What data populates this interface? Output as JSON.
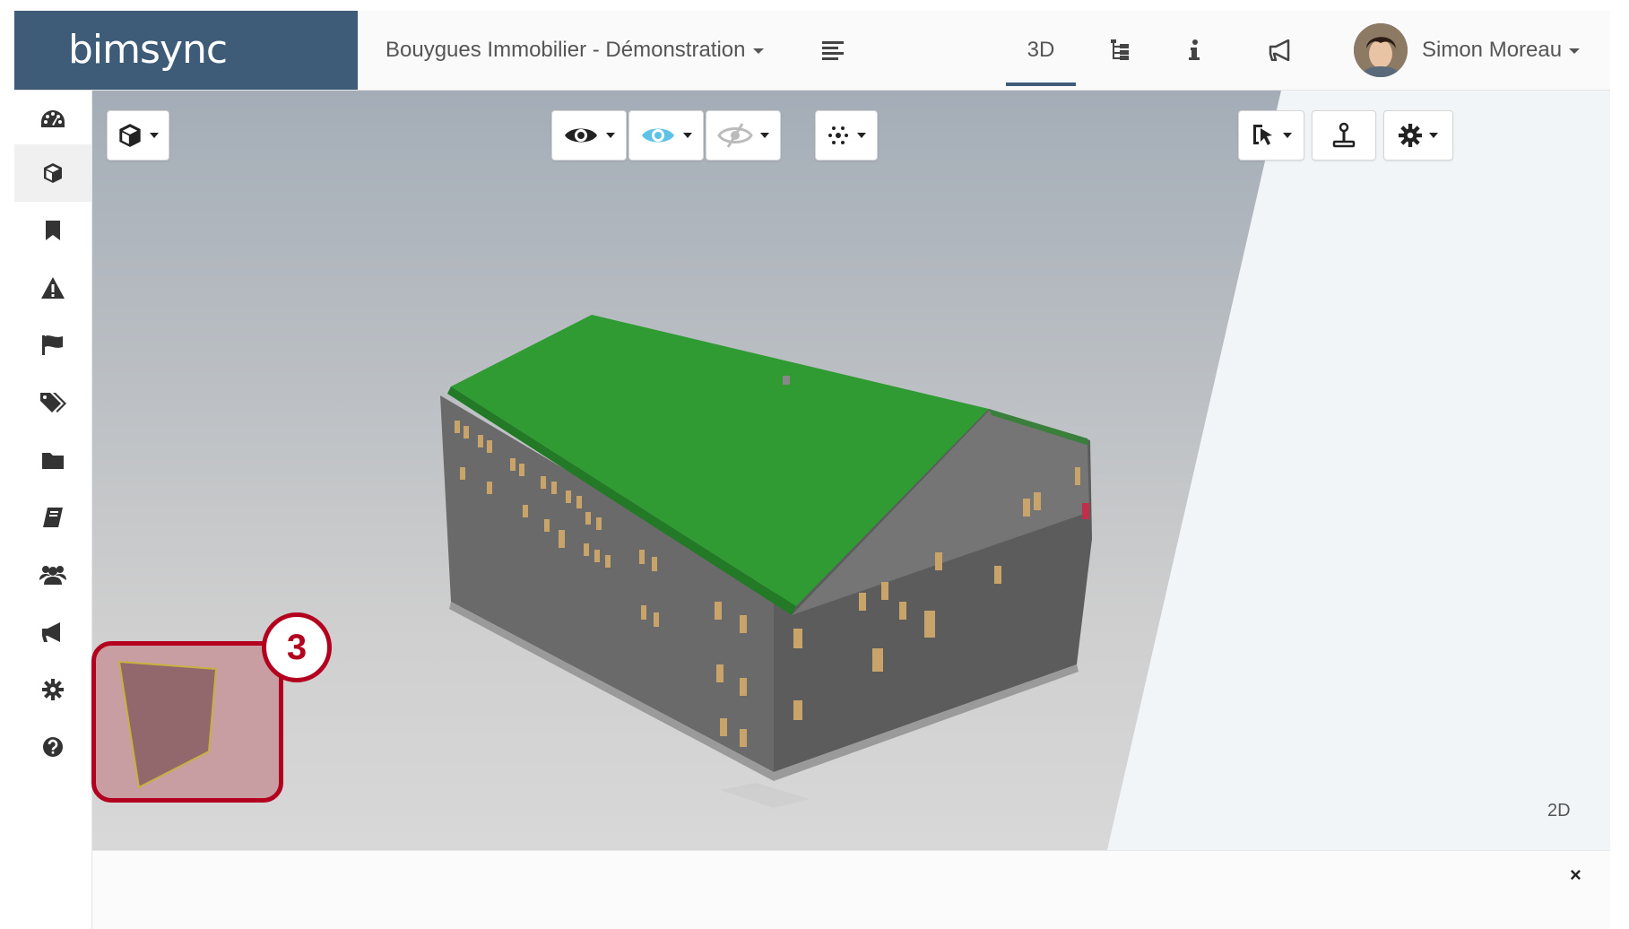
{
  "header": {
    "brand": "bimsync",
    "project": "Bouygues Immobilier - Démonstration",
    "nav": {
      "list_icon": "list-lines-icon",
      "tab_3d": "3D",
      "tree_icon": "tree-icon",
      "info_icon": "info-icon",
      "announce_icon": "megaphone-icon"
    },
    "user": "Simon Moreau"
  },
  "sidebar": {
    "items": [
      {
        "icon": "dashboard-icon"
      },
      {
        "icon": "cube-icon",
        "active": true
      },
      {
        "icon": "bookmark-icon"
      },
      {
        "icon": "warning-icon"
      },
      {
        "icon": "flag-icon"
      },
      {
        "icon": "tags-icon"
      },
      {
        "icon": "folder-icon"
      },
      {
        "icon": "book-icon"
      },
      {
        "icon": "users-icon"
      },
      {
        "icon": "megaphone-icon"
      },
      {
        "icon": "gear-icon"
      },
      {
        "icon": "help-icon"
      }
    ]
  },
  "viewer": {
    "toolbar": {
      "view_mode_icon": "cube-icon",
      "show_icon": "eye-icon",
      "xray_icon": "eye-blue-icon",
      "hide_icon": "eye-slash-icon",
      "explode_icon": "explode-icon",
      "select_icon": "cursor-icon",
      "joystick_icon": "joystick-icon",
      "settings_icon": "gear-icon"
    },
    "label_2d": "2D",
    "callout_number": "3"
  },
  "bottom_panel": {
    "close_label": "×"
  },
  "colors": {
    "brand_bg": "#3e5b77",
    "roof_green": "#2f9b32",
    "callout_red": "#b3001e"
  }
}
